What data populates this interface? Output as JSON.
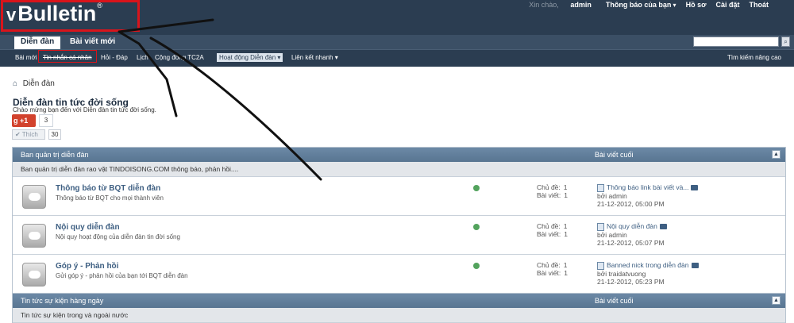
{
  "logo": {
    "text": "Bulletin",
    "mark": "v",
    "reg": "®"
  },
  "top_links": {
    "greeting": "Xin chào,",
    "user": "admin",
    "notifications": "Thông báo của bạn",
    "profile": "Hồ sơ",
    "settings": "Cài đặt",
    "logout": "Thoát"
  },
  "tabs": [
    {
      "label": "Diễn đàn",
      "active": true
    },
    {
      "label": "Bài viết mới",
      "active": false
    }
  ],
  "search": {
    "placeholder": ""
  },
  "navbar": {
    "items": [
      "Bài mới",
      "Tin nhắn cá nhân",
      "Hỏi - Đáp",
      "Lịch",
      "Cộng đồng TC2A",
      "Hoạt động Diễn đàn",
      "Liên kết nhanh"
    ],
    "advanced_search": "Tìm kiếm nâng cao"
  },
  "breadcrumb": "Diễn đàn",
  "page": {
    "title": "Diễn đàn tin tức đời sống",
    "description": "Chào mừng bạn đến với Diễn đàn tin tức đời sống."
  },
  "social": {
    "gplus_label": "+1",
    "gplus_count": "3",
    "like_label": "Thích",
    "like_count": "30"
  },
  "forums": [
    {
      "title": "Ban quản trị diễn đàn",
      "last_header": "Bài viết cuối",
      "description": "Ban quản trị diễn đàn rao vặt TINDOISONG.COM thông báo, phản hồi....",
      "rows": [
        {
          "title": "Thông báo từ BQT diễn đàn",
          "sub": "Thông báo từ BQT cho mọi thành viên",
          "topics_label": "Chủ đề:",
          "topics": "1",
          "posts_label": "Bài viết:",
          "posts": "1",
          "last_title": "Thông báo link bài viết và...",
          "last_by": "bởi admin",
          "last_time": "21-12-2012,",
          "last_clock": "05:00 PM"
        },
        {
          "title": "Nội quy diễn đàn",
          "sub": "Nội quy hoạt động của diễn đàn tin đời sống",
          "topics_label": "Chủ đề:",
          "topics": "1",
          "posts_label": "Bài viết:",
          "posts": "1",
          "last_title": "Nội quy diễn đàn",
          "last_by": "bởi admin",
          "last_time": "21-12-2012,",
          "last_clock": "05:07 PM"
        },
        {
          "title": "Góp ý - Phản hồi",
          "sub": "Gửi góp ý - phản hồi của bạn tới BQT diễn đàn",
          "topics_label": "Chủ đề:",
          "topics": "1",
          "posts_label": "Bài viết:",
          "posts": "1",
          "last_title": "Banned nick trong diễn đàn",
          "last_by": "bởi traidatvuong",
          "last_time": "21-12-2012,",
          "last_clock": "05:23 PM"
        }
      ]
    },
    {
      "title": "Tin tức sự kiện hàng ngày",
      "last_header": "Bài viết cuối",
      "description": "Tin tức sự kiện trong và ngoài nước",
      "rows": []
    }
  ],
  "colors": {
    "header": "#2b3d51",
    "accent": "#3e5f82",
    "annotation": "#d9141b"
  }
}
